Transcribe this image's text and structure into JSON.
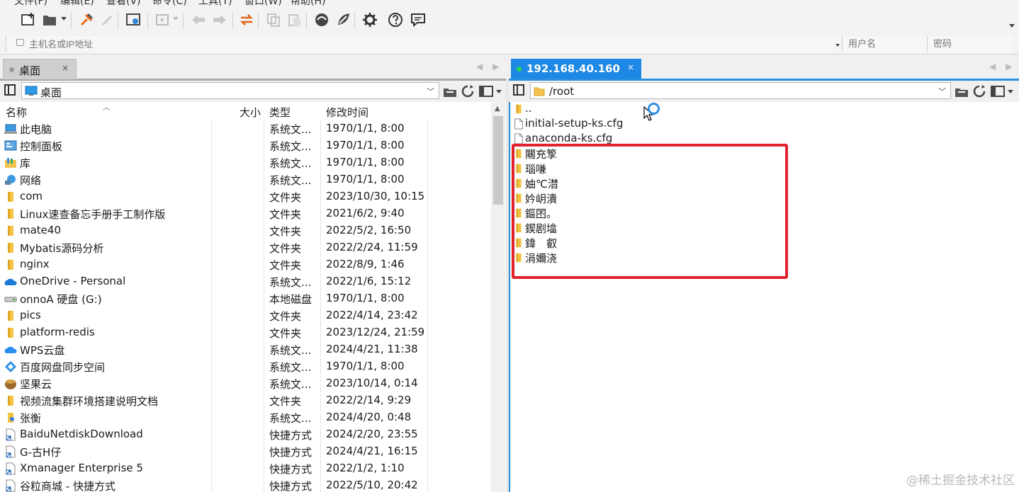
{
  "menubar": {
    "items": [
      "文件(F)",
      "编辑(E)",
      "查看(V)",
      "命令(C)",
      "工具(T)",
      "窗口(W)",
      "帮助(H)"
    ]
  },
  "toolbar": {
    "buttons": [
      {
        "name": "new-session-icon",
        "enabled": true
      },
      {
        "name": "open-folder-icon",
        "enabled": true,
        "has_dropdown": true
      },
      {
        "name": "connect-icon",
        "enabled": true
      },
      {
        "name": "disconnect-icon",
        "enabled": false
      },
      {
        "name": "session-properties-icon",
        "enabled": true
      },
      {
        "name": "transfer-icon",
        "enabled": false,
        "has_dropdown": true
      },
      {
        "name": "back-icon",
        "enabled": false
      },
      {
        "name": "forward-icon",
        "enabled": false
      },
      {
        "name": "swap-icon",
        "enabled": true
      },
      {
        "name": "copy-icon",
        "enabled": false
      },
      {
        "name": "paste-icon",
        "enabled": false
      },
      {
        "name": "xshell-icon",
        "enabled": true
      },
      {
        "name": "xftp-icon",
        "enabled": true
      },
      {
        "name": "options-gear-icon",
        "enabled": true
      },
      {
        "name": "help-icon",
        "enabled": true
      },
      {
        "name": "feedback-icon",
        "enabled": true
      }
    ]
  },
  "address": {
    "host_placeholder": "主机名或IP地址",
    "user_placeholder": "用户名",
    "password_placeholder": "密码"
  },
  "left_panel": {
    "tab_label": "桌面",
    "tab_close": "×",
    "path": "桌面",
    "columns": {
      "name": "名称",
      "size": "大小",
      "type": "类型",
      "modified": "修改时间"
    },
    "rows": [
      {
        "name": "此电脑",
        "type": "系统文...",
        "modified": "1970/1/1, 8:00",
        "icon": "computer-icon"
      },
      {
        "name": "控制面板",
        "type": "系统文...",
        "modified": "1970/1/1, 8:00",
        "icon": "control-panel-icon"
      },
      {
        "name": "库",
        "type": "系统文...",
        "modified": "1970/1/1, 8:00",
        "icon": "library-icon"
      },
      {
        "name": "网络",
        "type": "系统文...",
        "modified": "1970/1/1, 8:00",
        "icon": "network-icon"
      },
      {
        "name": "com",
        "type": "文件夹",
        "modified": "2023/10/30, 10:15",
        "icon": "folder-icon"
      },
      {
        "name": "Linux速查备忘手册手工制作版",
        "type": "文件夹",
        "modified": "2021/6/2, 9:40",
        "icon": "folder-icon"
      },
      {
        "name": "mate40",
        "type": "文件夹",
        "modified": "2022/5/2, 16:50",
        "icon": "folder-icon"
      },
      {
        "name": "Mybatis源码分析",
        "type": "文件夹",
        "modified": "2022/2/24, 11:59",
        "icon": "folder-icon"
      },
      {
        "name": "nginx",
        "type": "文件夹",
        "modified": "2022/8/9, 1:46",
        "icon": "folder-icon"
      },
      {
        "name": "OneDrive - Personal",
        "type": "系统文...",
        "modified": "2022/1/6, 15:12",
        "icon": "onedrive-icon"
      },
      {
        "name": "onnoA 硬盘 (G:)",
        "type": "本地磁盘",
        "modified": "1970/1/1, 8:00",
        "icon": "drive-icon"
      },
      {
        "name": "pics",
        "type": "文件夹",
        "modified": "2022/4/14, 23:42",
        "icon": "folder-icon"
      },
      {
        "name": "platform-redis",
        "type": "文件夹",
        "modified": "2023/12/24, 21:59",
        "icon": "folder-icon"
      },
      {
        "name": "WPS云盘",
        "type": "系统文...",
        "modified": "2024/4/21, 11:38",
        "icon": "wps-cloud-icon"
      },
      {
        "name": "百度网盘同步空间",
        "type": "系统文...",
        "modified": "1970/1/1, 8:00",
        "icon": "baidu-sync-icon"
      },
      {
        "name": "坚果云",
        "type": "系统文...",
        "modified": "2023/10/14, 0:14",
        "icon": "nutstore-icon"
      },
      {
        "name": "视频流集群环境搭建说明文档",
        "type": "文件夹",
        "modified": "2022/2/14, 9:29",
        "icon": "folder-icon"
      },
      {
        "name": "张衡",
        "type": "系统文...",
        "modified": "2024/4/20, 0:48",
        "icon": "user-folder-icon"
      },
      {
        "name": "BaiduNetdiskDownload",
        "type": "快捷方式",
        "modified": "2024/2/20, 23:55",
        "icon": "shortcut-icon"
      },
      {
        "name": "G-古H仔",
        "type": "快捷方式",
        "modified": "2024/4/21, 16:15",
        "icon": "shortcut-icon"
      },
      {
        "name": "Xmanager Enterprise 5",
        "type": "快捷方式",
        "modified": "2022/1/2, 1:10",
        "icon": "shortcut-icon"
      },
      {
        "name": "谷粒商城 - 快捷方式",
        "type": "快捷方式",
        "modified": "2022/5/10, 20:42",
        "icon": "shortcut-icon"
      }
    ]
  },
  "right_panel": {
    "tab_label": "192.168.40.160",
    "tab_close": "×",
    "connected_color": "#1fd45a",
    "path": "/root",
    "rows": [
      {
        "name": "..",
        "icon": "folder-icon"
      },
      {
        "name": "initial-setup-ks.cfg",
        "icon": "file-icon"
      },
      {
        "name": "anaconda-ks.cfg",
        "icon": "file-icon"
      },
      {
        "name": "闀充箰",
        "icon": "folder-icon"
      },
      {
        "name": "瑙嗛",
        "icon": "folder-icon"
      },
      {
        "name": "妯℃澘",
        "icon": "folder-icon"
      },
      {
        "name": "妗岄潰",
        "icon": "folder-icon"
      },
      {
        "name": "鏂囨。",
        "icon": "folder-icon"
      },
      {
        "name": "鍥剧墖",
        "icon": "folder-icon"
      },
      {
        "name": "鍏　叡",
        "icon": "folder-icon"
      },
      {
        "name": "涓嬭浇",
        "icon": "folder-icon"
      }
    ]
  },
  "highlight_color": "#e0232f",
  "watermark": "@稀土掘金技术社区"
}
